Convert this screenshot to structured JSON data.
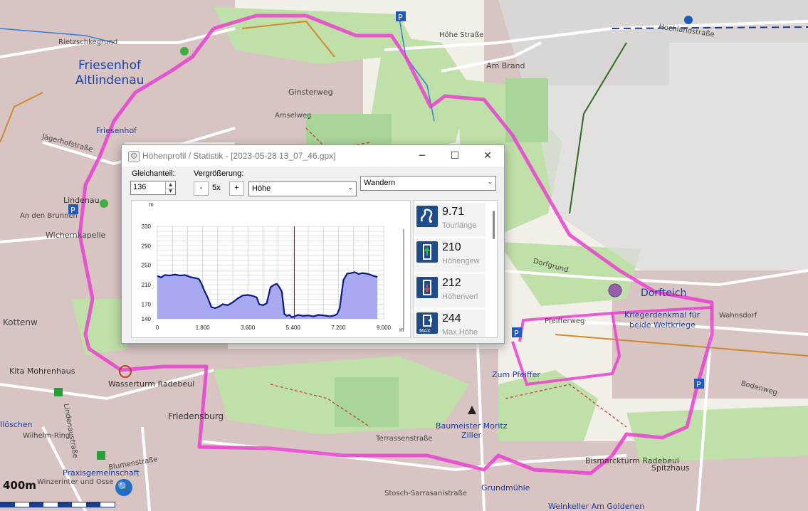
{
  "map": {
    "labels": {
      "friesenhof_altlindenau_1": "Friesenhof",
      "friesenhof_altlindenau_2": "Altlindenau",
      "friesenhof": "Friesenhof",
      "dorfteich": "Dorfteich",
      "kriegerdenkmal_1": "Kriegerdenkmal für",
      "kriegerdenkmal_2": "beide Weltkriege",
      "zum_pfeiffer": "Zum Pfeiffer",
      "kita": "Kita Mohrenhaus",
      "wasserturm": "Wasserturm Radebeul",
      "friedensburg": "Friedensburg",
      "baumeister_1": "Baumeister Moritz",
      "baumeister_2": "Ziller",
      "bismarckturm": "Bismarckturm Radebeul",
      "spitzhaus": "Spitzhaus",
      "grundmuehle": "Grundmühle",
      "weinkeller": "Weinkeller Am Goldenen",
      "praxis_1": "Praxisgemeinschaft",
      "praxis_2": "Winzerinter und Osse",
      "lindenau": "Lindenau",
      "wichernkapelle": "Wichernkapelle",
      "am_brand": "Am Brand",
      "ginsterweg": "Ginsterweg",
      "amselweg": "Amselweg",
      "hohe_strasse": "Höhe Straße",
      "hochlandstrasse": "Hochlandstraße",
      "dorfgrund": "Dorfgrund",
      "jaegerhofstrasse": "Jägerhofstraße",
      "an_den_brunnen": "An den Brunnen",
      "kottenweg": "Kottenw",
      "terrassenstrasse": "Terrassenstraße",
      "wahnsdorf": "Wahnsdorf",
      "rietzschkegrund": "Rietzschkegrund",
      "pfeifferweg": "Pfeifferweg",
      "bodenweg": "Bodenweg",
      "stosch": "Stosch-Sarrasanistraße",
      "blumenstrasse": "Blumenstraße",
      "lindenaustrasse": "Lindenaustraße",
      "hoflössnitz": "Ilöschen",
      "wilhelm_ring": "Wilhelm-Ring"
    },
    "scale_label": "400m"
  },
  "dialog": {
    "title": "Höhenprofil / Statistik - [2023-05-28 13_07_46.gpx]",
    "minimize": "─",
    "maximize": "☐",
    "close": "✕",
    "gleichanteil_label": "Gleichanteil:",
    "gleichanteil_value": "136",
    "vergroesserung_label": "Vergrößerung:",
    "zoom_minus": "-",
    "zoom_value": "5x",
    "zoom_plus": "+",
    "profile_select": "Höhe",
    "activity_select": "Wandern",
    "stats": [
      {
        "value": "9.71",
        "label": "Tourlänge",
        "icon": "route-icon"
      },
      {
        "value": "210",
        "label": "Höhengew",
        "icon": "ascent-icon"
      },
      {
        "value": "212",
        "label": "Höhenverl",
        "icon": "descent-icon"
      },
      {
        "value": "244",
        "label": "Max.Höhe",
        "icon": "max-height-icon"
      }
    ],
    "max_badge": "MAX"
  },
  "chart_data": {
    "type": "area",
    "ylabel": "m",
    "xlabel": "m",
    "ylim": [
      140,
      330
    ],
    "xlim": [
      0,
      9000
    ],
    "yticks": [
      140,
      170,
      210,
      250,
      290,
      330
    ],
    "xticks": [
      0,
      1800,
      3600,
      5400,
      7200,
      9000
    ],
    "ytick_labels": [
      "140",
      "170",
      "210",
      "250",
      "290",
      "330"
    ],
    "xtick_labels": [
      "0",
      "1.800",
      "3.600",
      "5.400",
      "7.200",
      "9.000"
    ],
    "cursor_x": 5450,
    "colors": {
      "fill": "#a9a9f2",
      "line": "#0d1a82",
      "cursor": "#cc0000"
    },
    "x": [
      0,
      150,
      300,
      500,
      700,
      900,
      1100,
      1300,
      1500,
      1650,
      1750,
      1850,
      2000,
      2150,
      2300,
      2450,
      2600,
      2800,
      3000,
      3200,
      3400,
      3600,
      3800,
      3950,
      4050,
      4200,
      4350,
      4500,
      4650,
      4750,
      4850,
      4950,
      5050,
      5150,
      5250,
      5350,
      5450,
      5600,
      5800,
      6000,
      6200,
      6400,
      6600,
      6750,
      6850,
      6950,
      7050,
      7150,
      7250,
      7400,
      7550,
      7700,
      7850,
      8000,
      8150,
      8300,
      8450,
      8600,
      8750
    ],
    "values": [
      228,
      225,
      230,
      229,
      231,
      229,
      230,
      226,
      224,
      222,
      213,
      200,
      184,
      164,
      162,
      165,
      170,
      168,
      174,
      182,
      188,
      189,
      187,
      184,
      170,
      168,
      172,
      205,
      210,
      212,
      205,
      196,
      150,
      146,
      148,
      143,
      145,
      148,
      146,
      147,
      145,
      148,
      147,
      146,
      145,
      146,
      147,
      150,
      162,
      220,
      233,
      234,
      236,
      232,
      234,
      233,
      231,
      228,
      226
    ]
  }
}
